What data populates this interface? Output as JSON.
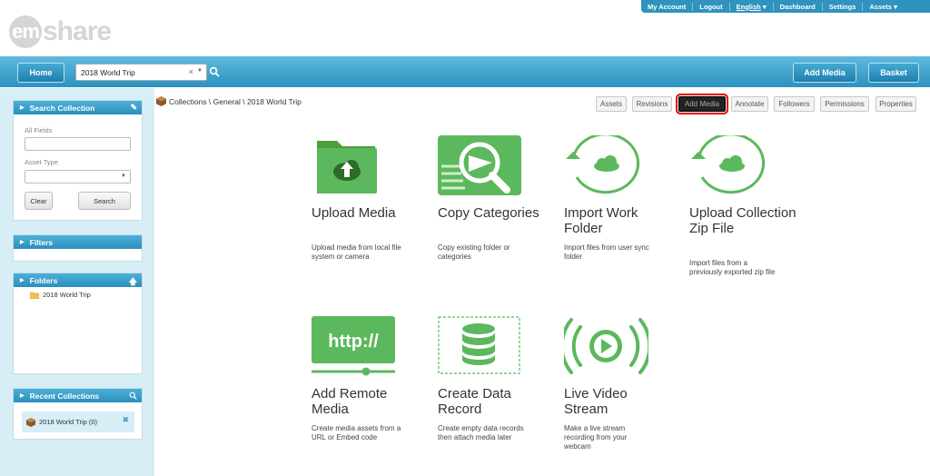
{
  "topnav": {
    "my_account": "My Account",
    "logout": "Logout",
    "language": "English",
    "dashboard": "Dashboard",
    "settings": "Settings",
    "assets": "Assets"
  },
  "logo": {
    "em": "em",
    "share": "share"
  },
  "toolbar": {
    "home": "Home",
    "collection": "2018 World Trip",
    "add_media": "Add Media",
    "basket": "Basket"
  },
  "search_panel": {
    "title": "Search Collection",
    "all_fields": "All Fields",
    "asset_type": "Asset Type",
    "clear": "Clear",
    "search": "Search"
  },
  "filters_panel": {
    "title": "Filters"
  },
  "folders_panel": {
    "title": "Folders",
    "item": "2018 World Trip"
  },
  "recent_panel": {
    "title": "Recent Collections",
    "item": "2018 World Trip (0)"
  },
  "breadcrumb": "Collections \\ General \\ 2018 World Trip",
  "tabs": [
    "Assets",
    "Revisions",
    "Add Media",
    "Annotate",
    "Followers",
    "Permissions",
    "Properties"
  ],
  "tiles": [
    {
      "title": "Upload Media",
      "desc": "Upload media from local file system or camera",
      "icon": "upload-folder-icon"
    },
    {
      "title": "Copy Categories",
      "desc": "Copy existing folder or categories",
      "icon": "copy-categories-icon"
    },
    {
      "title": "Import Work Folder",
      "desc": "Import files from user sync folder",
      "icon": "import-sync-icon"
    },
    {
      "title": "Upload Collection Zip File",
      "desc": "Import files from a previously exported zip file",
      "icon": "upload-zip-sync-icon"
    },
    {
      "title": "Add Remote Media",
      "desc": "Create media assets from a URL or Embed code",
      "icon": "http-remote-icon"
    },
    {
      "title": "Create Data Record",
      "desc": "Create empty data records then attach media later",
      "icon": "database-icon"
    },
    {
      "title": "Live Video Stream",
      "desc": "Make a live stream recording from your webcam",
      "icon": "live-stream-icon"
    }
  ],
  "colors": {
    "accent": "#2b92c0",
    "tile_green": "#5cb85c",
    "highlight": "#e00000"
  }
}
